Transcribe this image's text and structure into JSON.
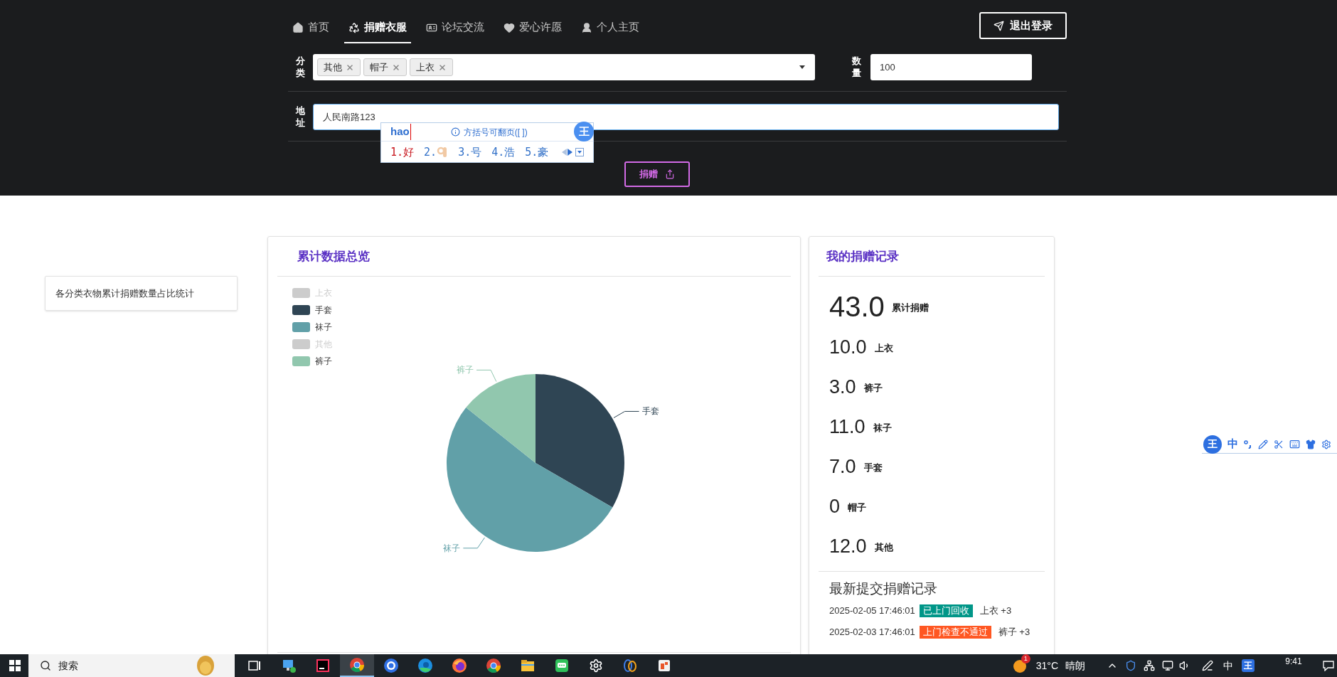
{
  "nav": {
    "tabs": [
      {
        "label": "首页",
        "kind": "home",
        "selected": false
      },
      {
        "label": "捐赠衣服",
        "kind": "recycle",
        "selected": true
      },
      {
        "label": "论坛交流",
        "kind": "card",
        "selected": false
      },
      {
        "label": "爱心许愿",
        "kind": "heart",
        "selected": false
      },
      {
        "label": "个人主页",
        "kind": "user",
        "selected": false
      }
    ],
    "logout": "退出登录"
  },
  "form": {
    "category": {
      "label": "分类",
      "tags": [
        "其他",
        "帽子",
        "上衣"
      ]
    },
    "quantity": {
      "label": "数量",
      "value": "100"
    },
    "address": {
      "label": "地址",
      "value": "人民南路123"
    },
    "submit": "捐赠"
  },
  "ime_popup": {
    "composition": "hao",
    "hint": "方括号可翻页([ ])",
    "logo": "王",
    "candidates": [
      {
        "index": "1.",
        "text": "好",
        "kind": "text",
        "selected": true
      },
      {
        "index": "2.",
        "kind": "emoji",
        "selected": false
      },
      {
        "index": "3.",
        "text": "号",
        "kind": "text",
        "selected": false
      },
      {
        "index": "4.",
        "text": "浩",
        "kind": "text",
        "selected": false
      },
      {
        "index": "5.",
        "text": "豪",
        "kind": "text",
        "selected": false
      }
    ]
  },
  "sidebar_card": "各分类衣物累计捐赠数量占比统计",
  "overview": {
    "title": "累计数据总览",
    "legend": [
      {
        "label": "上衣",
        "selected": false
      },
      {
        "label": "手套",
        "selected": true,
        "color": "#2f4554"
      },
      {
        "label": "袜子",
        "selected": true,
        "color": "#61a0a8"
      },
      {
        "label": "其他",
        "selected": false
      },
      {
        "label": "裤子",
        "selected": true,
        "color": "#91c7ae"
      }
    ],
    "chart_data": {
      "type": "pie",
      "categories": [
        "手套",
        "袜子",
        "裤子"
      ],
      "values": [
        33.33,
        52.38,
        14.29
      ]
    }
  },
  "records": {
    "title": "我的捐赠记录",
    "total": {
      "value": "43.0",
      "label": "累计捐赠"
    },
    "items": [
      {
        "value": "10.0",
        "label": "上衣"
      },
      {
        "value": "3.0",
        "label": "裤子"
      },
      {
        "value": "11.0",
        "label": "袜子"
      },
      {
        "value": "7.0",
        "label": "手套"
      },
      {
        "value": "0",
        "label": "帽子"
      },
      {
        "value": "12.0",
        "label": "其他"
      }
    ],
    "latest_title": "最新提交捐赠记录",
    "latest": [
      {
        "time": "2025-02-05 17:46:01",
        "status": "已上门回收",
        "color": "#009688",
        "item": "上衣 +3"
      },
      {
        "time": "2025-02-03 17:46:01",
        "status": "上门检查不通过",
        "color": "#ff5722",
        "item": "裤子 +3"
      }
    ]
  },
  "ime_toolbar": {
    "logo": "王",
    "mode": "中"
  },
  "taskbar": {
    "search_placeholder": "搜索",
    "apps": [
      {
        "kind": "task-view",
        "selected": false
      },
      {
        "kind": "remote",
        "selected": false
      },
      {
        "kind": "ide",
        "selected": false
      },
      {
        "kind": "chrome",
        "selected": true
      },
      {
        "kind": "blue-circle",
        "selected": false
      },
      {
        "kind": "edge",
        "selected": false
      },
      {
        "kind": "firefox",
        "selected": false
      },
      {
        "kind": "chrome",
        "selected": false
      },
      {
        "kind": "folder",
        "selected": false
      },
      {
        "kind": "chat",
        "selected": false
      },
      {
        "kind": "gear",
        "selected": false
      },
      {
        "kind": "loops",
        "selected": false
      },
      {
        "kind": "app",
        "selected": false
      }
    ],
    "weather": {
      "badge": "1",
      "temp": "31°C",
      "text": "晴朗"
    },
    "ime_mode": "中",
    "ime_logo": "王",
    "time": "9:41"
  }
}
